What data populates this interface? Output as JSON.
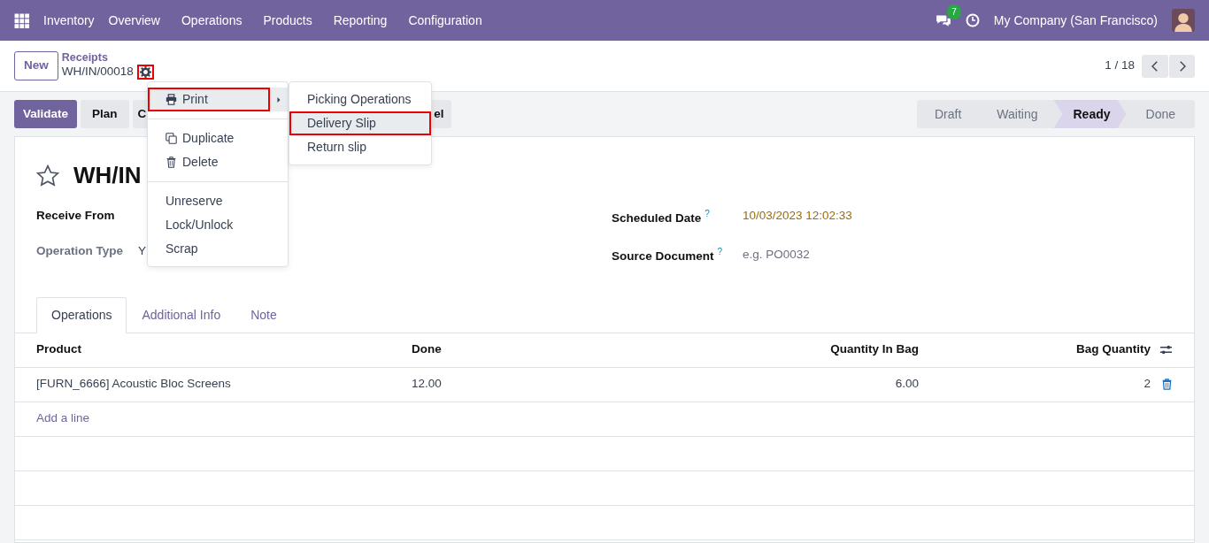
{
  "navbar": {
    "app": "Inventory",
    "menus": [
      "Overview",
      "Operations",
      "Products",
      "Reporting",
      "Configuration"
    ],
    "messages_badge": "7",
    "company": "My Company (San Francisco)"
  },
  "control_panel": {
    "new_button": "New",
    "breadcrumb": "Receipts",
    "record": "WH/IN/00018",
    "gear_highlighted": true,
    "pager": "1 / 18"
  },
  "action_buttons": [
    {
      "label": "Validate",
      "primary": true
    },
    {
      "label": "Plan",
      "primary": false
    },
    {
      "label": "C",
      "primary": false
    },
    {
      "label": "el",
      "primary": false
    }
  ],
  "statusbar": [
    {
      "label": "Draft",
      "selected": false
    },
    {
      "label": "Waiting",
      "selected": false
    },
    {
      "label": "Ready",
      "selected": true
    },
    {
      "label": "Done",
      "selected": false
    }
  ],
  "record": {
    "title": "WH/IN",
    "starred": false,
    "fields_left": [
      {
        "label": "Receive From"
      },
      {
        "label": "Operation Type",
        "value": "Y"
      }
    ],
    "fields_right": [
      {
        "label": "Scheduled Date",
        "help": "?",
        "value": "10/03/2023 12:02:33",
        "kind": "date"
      },
      {
        "label": "Source Document",
        "help": "?",
        "placeholder": "e.g. PO0032",
        "kind": "input"
      }
    ]
  },
  "tabs": [
    {
      "label": "Operations",
      "selected": true
    },
    {
      "label": "Additional Info",
      "selected": false
    },
    {
      "label": "Note",
      "selected": false
    }
  ],
  "table": {
    "columns": [
      "Product",
      "Done",
      "Quantity In Bag",
      "Bag Quantity"
    ],
    "rows": [
      {
        "cells": [
          "[FURN_6666] Acoustic Bloc Screens",
          "12.00",
          "6.00",
          "2"
        ]
      }
    ],
    "add_line": "Add a line"
  },
  "gear_menu": {
    "sections": [
      {
        "items": [
          {
            "label": "Print",
            "kind": "printer",
            "has_submenu": true,
            "highlighted": true
          }
        ]
      },
      {
        "items": [
          {
            "label": "Duplicate",
            "kind": "copy",
            "has_submenu": false,
            "highlighted": false
          },
          {
            "label": "Delete",
            "kind": "trash",
            "has_submenu": false,
            "highlighted": false
          }
        ]
      },
      {
        "items": [
          {
            "label": "Unreserve",
            "kind": "plain",
            "has_submenu": false,
            "highlighted": false
          },
          {
            "label": "Lock/Unlock",
            "kind": "plain",
            "has_submenu": false,
            "highlighted": false
          },
          {
            "label": "Scrap",
            "kind": "plain",
            "has_submenu": false,
            "highlighted": false
          }
        ]
      }
    ]
  },
  "print_submenu": [
    {
      "label": "Picking Operations",
      "highlighted": false
    },
    {
      "label": "Delivery Slip",
      "highlighted": true
    },
    {
      "label": "Return slip",
      "highlighted": false
    }
  ]
}
